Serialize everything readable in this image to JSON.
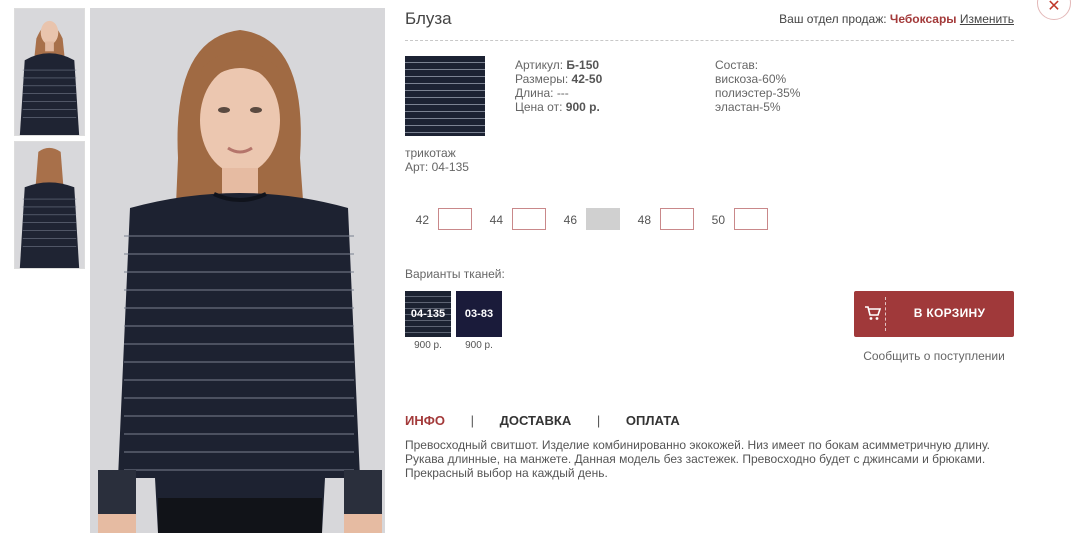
{
  "product": {
    "title": "Блуза",
    "sales_dept_label": "Ваш отдел продаж:",
    "sales_city": "Чебоксары",
    "change_label": "Изменить"
  },
  "fabric": {
    "name": "трикотаж",
    "art": "Арт: 04-135"
  },
  "info_left": {
    "article_label": "Артикул:",
    "article_value": "Б-150",
    "sizes_label": "Размеры:",
    "sizes_value": "42-50",
    "length_label": "Длина:",
    "length_value": "---",
    "price_label": "Цена от:",
    "price_value": "900 р."
  },
  "info_right": {
    "composition_label": "Состав:",
    "items": [
      "вискоза-60%",
      "полиэстер-35%",
      "эластан-5%"
    ]
  },
  "sizes": [
    {
      "label": "42",
      "available": true
    },
    {
      "label": "44",
      "available": true
    },
    {
      "label": "46",
      "available": false
    },
    {
      "label": "48",
      "available": true
    },
    {
      "label": "50",
      "available": true
    }
  ],
  "variants": {
    "label": "Варианты тканей:",
    "items": [
      {
        "code": "04-135",
        "price": "900 р."
      },
      {
        "code": "03-83",
        "price": "900 р."
      }
    ]
  },
  "cart": {
    "button_label": "В КОРЗИНУ",
    "notify_label": "Сообщить о поступлении"
  },
  "tabs": {
    "info": "ИНФО",
    "delivery": "ДОСТАВКА",
    "payment": "ОПЛАТА",
    "separator": "|"
  },
  "description": "Превосходный свитшот. Изделие комбинированно экокожей. Низ имеет по бокам асимметричную длину. Рукава длинные, на манжете. Данная модель без застежек. Превосходно будет с джинсами и брюками. Прекрасный выбор на каждый день.",
  "colors": {
    "accent": "#a0393a",
    "fabric_dark": "#1c2233",
    "variant_2": "#1a1b3a"
  },
  "icons": {
    "close": "close-icon",
    "cart": "cart-icon"
  }
}
